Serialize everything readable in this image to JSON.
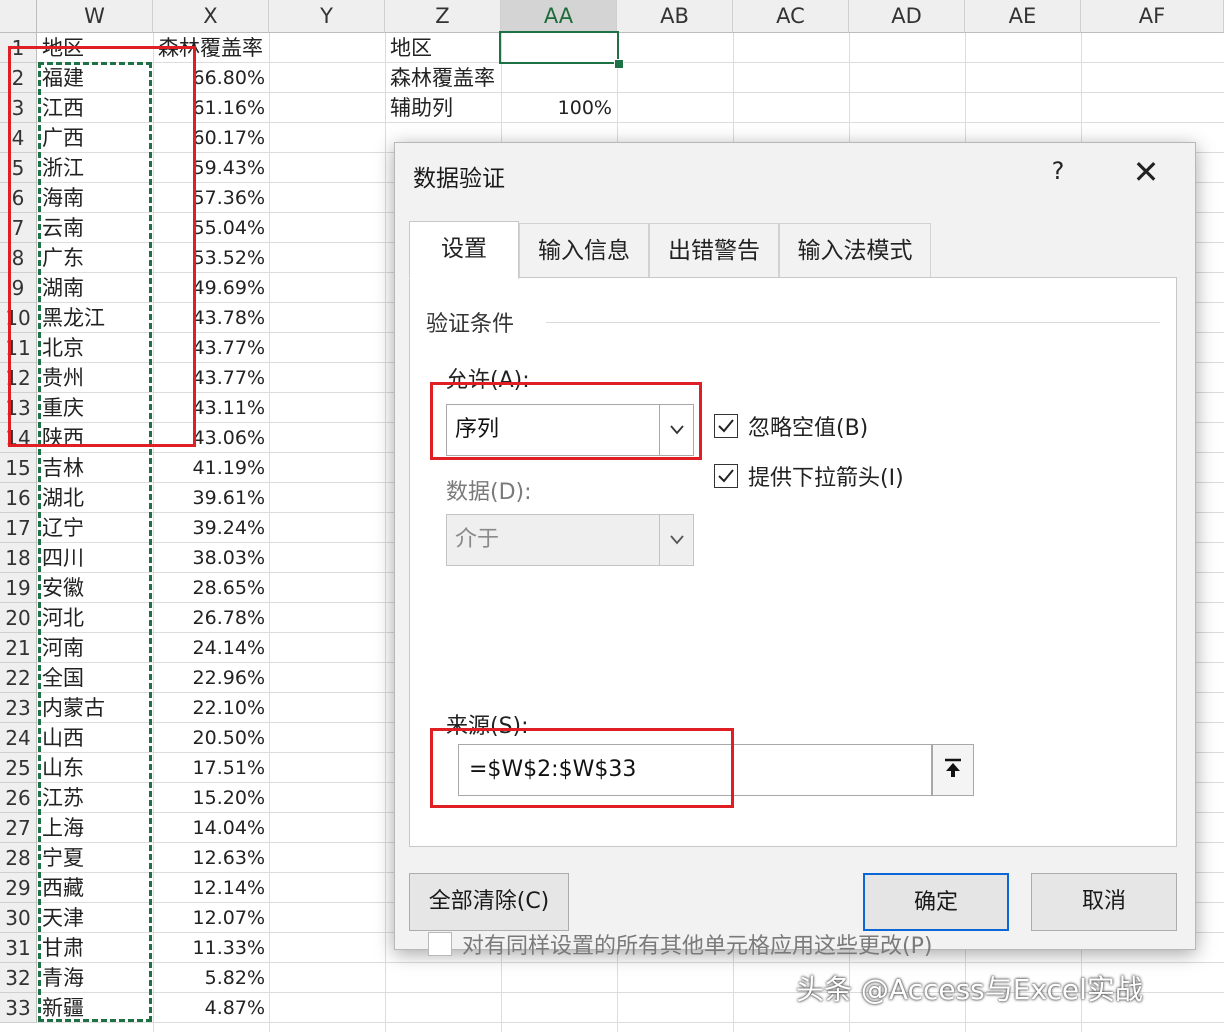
{
  "columns": [
    "W",
    "X",
    "Y",
    "Z",
    "AA",
    "AB",
    "AC",
    "AD",
    "AE",
    "AF"
  ],
  "selected_column": "AA",
  "rows": [
    {
      "num": "1",
      "w": "地区",
      "x": "森林覆盖率"
    },
    {
      "num": "2",
      "w": "福建",
      "x": "66.80%"
    },
    {
      "num": "3",
      "w": "江西",
      "x": "61.16%"
    },
    {
      "num": "4",
      "w": "广西",
      "x": "60.17%"
    },
    {
      "num": "5",
      "w": "浙江",
      "x": "59.43%"
    },
    {
      "num": "6",
      "w": "海南",
      "x": "57.36%"
    },
    {
      "num": "7",
      "w": "云南",
      "x": "55.04%"
    },
    {
      "num": "8",
      "w": "广东",
      "x": "53.52%"
    },
    {
      "num": "9",
      "w": "湖南",
      "x": "49.69%"
    },
    {
      "num": "10",
      "w": "黑龙江",
      "x": "43.78%"
    },
    {
      "num": "11",
      "w": "北京",
      "x": "43.77%"
    },
    {
      "num": "12",
      "w": "贵州",
      "x": "43.77%"
    },
    {
      "num": "13",
      "w": "重庆",
      "x": "43.11%"
    },
    {
      "num": "14",
      "w": "陕西",
      "x": "43.06%"
    },
    {
      "num": "15",
      "w": "吉林",
      "x": "41.19%"
    },
    {
      "num": "16",
      "w": "湖北",
      "x": "39.61%"
    },
    {
      "num": "17",
      "w": "辽宁",
      "x": "39.24%"
    },
    {
      "num": "18",
      "w": "四川",
      "x": "38.03%"
    },
    {
      "num": "19",
      "w": "安徽",
      "x": "28.65%"
    },
    {
      "num": "20",
      "w": "河北",
      "x": "26.78%"
    },
    {
      "num": "21",
      "w": "河南",
      "x": "24.14%"
    },
    {
      "num": "22",
      "w": "全国",
      "x": "22.96%"
    },
    {
      "num": "23",
      "w": "内蒙古",
      "x": "22.10%"
    },
    {
      "num": "24",
      "w": "山西",
      "x": "20.50%"
    },
    {
      "num": "25",
      "w": "山东",
      "x": "17.51%"
    },
    {
      "num": "26",
      "w": "江苏",
      "x": "15.20%"
    },
    {
      "num": "27",
      "w": "上海",
      "x": "14.04%"
    },
    {
      "num": "28",
      "w": "宁夏",
      "x": "12.63%"
    },
    {
      "num": "29",
      "w": "西藏",
      "x": "12.14%"
    },
    {
      "num": "30",
      "w": "天津",
      "x": "12.07%"
    },
    {
      "num": "31",
      "w": "甘肃",
      "x": "11.33%"
    },
    {
      "num": "32",
      "w": "青海",
      "x": "5.82%"
    },
    {
      "num": "33",
      "w": "新疆",
      "x": "4.87%"
    }
  ],
  "side_table": {
    "z1": "地区",
    "z2": "森林覆盖率",
    "z3": "辅助列",
    "aa3": "100%"
  },
  "dialog": {
    "title": "数据验证",
    "help": "?",
    "close": "✕",
    "tabs": [
      "设置",
      "输入信息",
      "出错警告",
      "输入法模式"
    ],
    "active_tab": 0,
    "group_label": "验证条件",
    "allow_label": "允许(A):",
    "allow_value": "序列",
    "data_label": "数据(D):",
    "data_value": "介于",
    "ignore_blank_label": "忽略空值(B)",
    "ignore_blank_checked": true,
    "dropdown_label": "提供下拉箭头(I)",
    "dropdown_checked": true,
    "source_label": "来源(S):",
    "source_value": "=$W$2:$W$33",
    "apply_all_label": "对有同样设置的所有其他单元格应用这些更改(P)",
    "apply_all_checked": false,
    "clear_all": "全部清除(C)",
    "ok": "确定",
    "cancel": "取消"
  },
  "watermark": "头条 @Access与Excel实战",
  "colors": {
    "accent_green": "#1e7145",
    "highlight_red": "#e01f25",
    "default_button_blue": "#0b66d6"
  }
}
